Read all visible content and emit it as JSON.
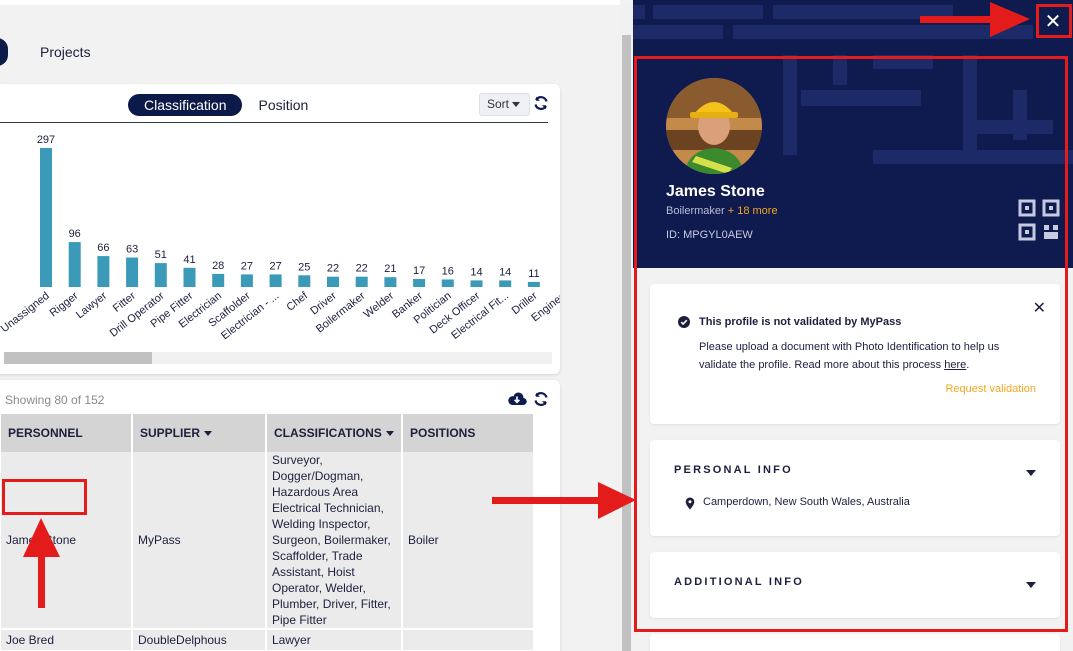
{
  "nav": {
    "projects_label": "Projects"
  },
  "chart_panel": {
    "tabs": [
      {
        "label": "Classification",
        "active": true
      },
      {
        "label": "Position",
        "active": false
      }
    ],
    "sort_label": "Sort"
  },
  "chart_data": {
    "type": "bar",
    "categories": [
      "Unassigned",
      "Rigger",
      "Lawyer",
      "Fitter",
      "Drill Operator",
      "Pipe Fitter",
      "Electrician",
      "Scaffolder",
      "Electrician - ...",
      "Chef",
      "Driver",
      "Boilermaker",
      "Welder",
      "Banker",
      "Politician",
      "Deck Officer",
      "Electrical Fit...",
      "Driller",
      "Enginee"
    ],
    "values": [
      297,
      96,
      66,
      63,
      51,
      41,
      28,
      27,
      27,
      25,
      22,
      22,
      21,
      17,
      16,
      14,
      14,
      11,
      null
    ],
    "value_labels": [
      "297",
      "96",
      "66",
      "63",
      "51",
      "41",
      "28",
      "27",
      "27",
      "25",
      "22",
      "22",
      "21",
      "17",
      "16",
      "14",
      "14",
      "11",
      ""
    ],
    "bar_color": "#3a9ab8",
    "ylim": [
      0,
      297
    ]
  },
  "table_panel": {
    "showing": "Showing 80 of 152",
    "columns": [
      {
        "label": "PERSONNEL",
        "sortable": false
      },
      {
        "label": "SUPPLIER",
        "sortable": true
      },
      {
        "label": "CLASSIFICATIONS",
        "sortable": true
      },
      {
        "label": "POSITIONS",
        "sortable": false
      }
    ],
    "rows": [
      {
        "personnel": "James Stone",
        "supplier": "MyPass",
        "classifications": "Surveyor, Dogger/Dogman, Hazardous Area Electrical Technician, Welding Inspector, Surgeon, Boilermaker, Scaffolder, Trade Assistant, Hoist Operator, Welder, Plumber, Driver, Fitter, Pipe Fitter",
        "positions": "Boiler"
      },
      {
        "personnel": "Joe Bred",
        "supplier": "DoubleDelphous",
        "classifications": "Lawyer",
        "positions": ""
      }
    ]
  },
  "profile": {
    "name": "James Stone",
    "role": "Boilermaker",
    "more": "+ 18 more",
    "id_text": "ID: MPGYL0AEW",
    "close_symbol": "✕"
  },
  "validation": {
    "title": "This profile is not validated by MyPass",
    "body": "Please upload a document with Photo Identification to help us validate the profile. Read more about this process ",
    "link": "here",
    "after_link": ".",
    "request": "Request validation",
    "dismiss_symbol": "✕"
  },
  "personal_info": {
    "title": "PERSONAL INFO",
    "location": "Camperdown, New South Wales, Australia"
  },
  "additional_info": {
    "title": "ADDITIONAL INFO"
  },
  "colors": {
    "navy": "#0f1a4f",
    "accent": "#f5a623",
    "annotation": "#e31b1b",
    "bar": "#3a9ab8"
  }
}
